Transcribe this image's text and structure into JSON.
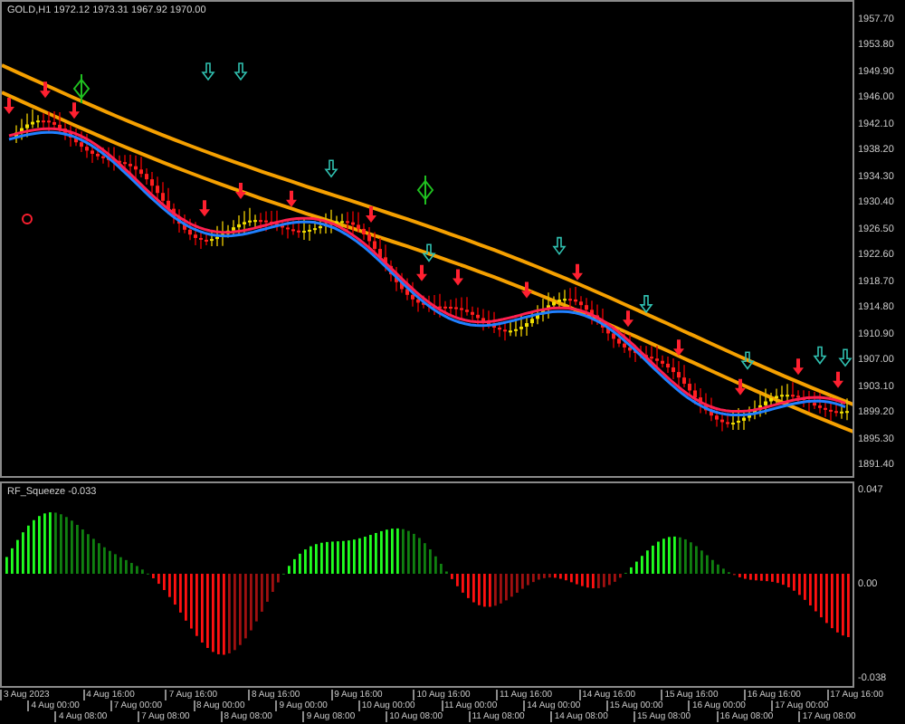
{
  "price_pane": {
    "header": "GOLD,H1  1972.12 1973.31 1967.92 1970.00",
    "axis": [
      "1957.70",
      "1953.80",
      "1949.90",
      "1946.00",
      "1942.10",
      "1938.20",
      "1934.30",
      "1930.40",
      "1926.50",
      "1922.60",
      "1918.70",
      "1914.80",
      "1910.90",
      "1907.00",
      "1903.10",
      "1899.20",
      "1895.30",
      "1891.40"
    ]
  },
  "indicator_pane": {
    "label": "RF_Squeeze -0.033",
    "axis": [
      "0.047",
      "0.00",
      "-0.038"
    ]
  },
  "time_axis": [
    "3 Aug 2023",
    "4 Aug 00:00",
    "4 Aug 08:00",
    "4 Aug 16:00",
    "7 Aug 00:00",
    "7 Aug 08:00",
    "7 Aug 16:00",
    "8 Aug 00:00",
    "8 Aug 08:00",
    "8 Aug 16:00",
    "9 Aug 00:00",
    "9 Aug 08:00",
    "9 Aug 16:00",
    "10 Aug 00:00",
    "10 Aug 08:00",
    "10 Aug 16:00",
    "11 Aug 00:00",
    "11 Aug 08:00",
    "11 Aug 16:00",
    "14 Aug 00:00",
    "14 Aug 08:00",
    "14 Aug 16:00",
    "15 Aug 00:00",
    "15 Aug 08:00",
    "15 Aug 16:00",
    "16 Aug 00:00",
    "16 Aug 08:00",
    "16 Aug 16:00",
    "17 Aug 00:00",
    "17 Aug 08:00",
    "17 Aug 16:00"
  ]
}
